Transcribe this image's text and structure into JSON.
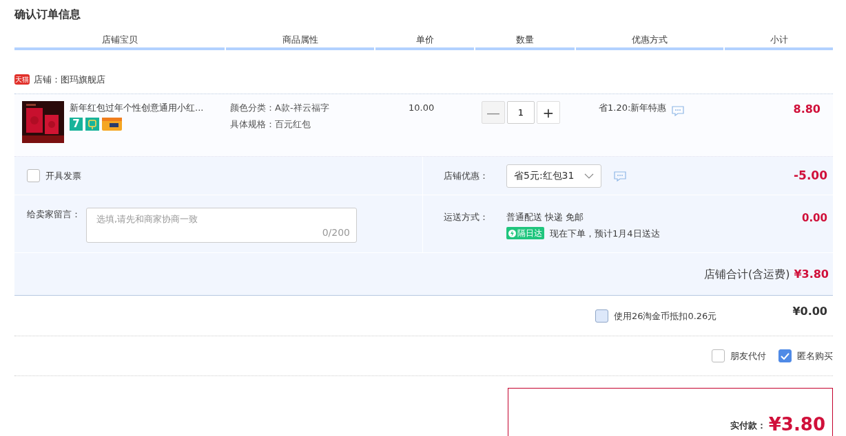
{
  "title": "确认订单信息",
  "columns": [
    "店铺宝贝",
    "商品属性",
    "单价",
    "数量",
    "优惠方式",
    "小计"
  ],
  "shop": {
    "badge": "天猫",
    "label": "店铺：图玛旗舰店"
  },
  "items": [
    {
      "name": "新年红包过年个性创意通用小红...",
      "service_badge": "7",
      "attributes": [
        {
          "label": "颜色分类：",
          "value": "A款-祥云福字"
        },
        {
          "label": "具体规格：",
          "value": "百元红包"
        }
      ],
      "unit_price": "10.00",
      "minus": "—",
      "minus_disabled": true,
      "quantity": "1",
      "plus": "+",
      "discount": "省1.20:新年特惠",
      "subtotal": "8.80"
    }
  ],
  "invoice": {
    "label": "开具发票",
    "checked": false
  },
  "message": {
    "label": "给卖家留言：",
    "placeholder": "选填,请先和商家协商一致",
    "counter": "0/200"
  },
  "store_discount": {
    "label": "店铺优惠：",
    "value": "省5元:红包31",
    "amount": "-5.00"
  },
  "shipping": {
    "label": "运送方式：",
    "method": "普通配送 快递 免邮",
    "badge": "隔日达",
    "note": "现在下单，预计1月4日送达",
    "amount": "0.00"
  },
  "store_total": {
    "label": "店铺合计(含运费)",
    "amount": "¥3.80"
  },
  "coins": {
    "label": "使用26淘金币抵扣0.26元",
    "checked": false,
    "amount": "¥0.00"
  },
  "options": [
    {
      "label": "朋友代付",
      "checked": false
    },
    {
      "label": "匿名购买",
      "checked": true
    }
  ],
  "payment": {
    "label": "实付款：",
    "amount": "¥3.80"
  }
}
